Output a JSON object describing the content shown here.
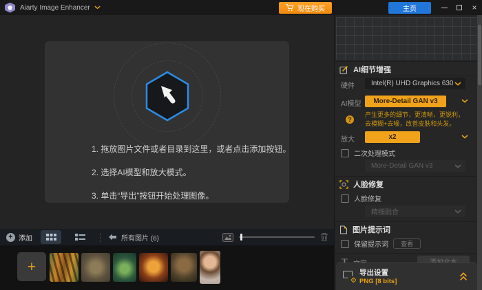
{
  "titlebar": {
    "app_title": "Aiarty Image Enhancer",
    "buy_label": "现在购买",
    "home_label": "主页"
  },
  "main": {
    "instructions": [
      "1. 拖放图片文件或者目录到这里，或者点击添加按钮。",
      "2. 选择AI模型和放大模式。",
      "3. 单击“导出”按钮开始处理图像。"
    ]
  },
  "toolbar": {
    "add_label": "添加",
    "all_images_label": "所有图片 (6)"
  },
  "thumbnails": [
    "tiger",
    "butterfly",
    "terrarium-jar",
    "burger",
    "dog",
    "portrait-woman"
  ],
  "panel": {
    "ai": {
      "title": "AI细节增强",
      "hardware_label": "硬件",
      "hardware_value": "Intel(R) UHD Graphics 630",
      "model_label": "AI模型",
      "model_value": "More-Detail GAN  v3",
      "hint_line1": "产生更多的细节，更清晰，更锐利，",
      "hint_line2": "去模糊+去噪，改善皮肤和头发。",
      "scale_label": "放大",
      "scale_value": "x2",
      "secondary_label": "二次处理模式",
      "secondary_value": "More-Detail GAN  v3"
    },
    "face": {
      "title": "人脸修复",
      "checkbox_label": "人脸修复",
      "mode_value": "精细融合"
    },
    "prompt": {
      "title": "图片提示词",
      "keep_label": "保留提示词",
      "view_label": "查看",
      "text_label": "文字",
      "add_text_label": "添加文本"
    },
    "export": {
      "title": "导出设置",
      "format": "PNG  [8 bits]"
    }
  },
  "icons": {
    "plus": "+",
    "close": "×",
    "question": "?",
    "gear": "⚙",
    "text_tool": "T"
  },
  "colors": {
    "accent_yellow": "#f0a31a",
    "buy_orange": "#ef8a0d",
    "home_blue": "#2176d9",
    "hexagon_blue": "#2e8be6"
  }
}
